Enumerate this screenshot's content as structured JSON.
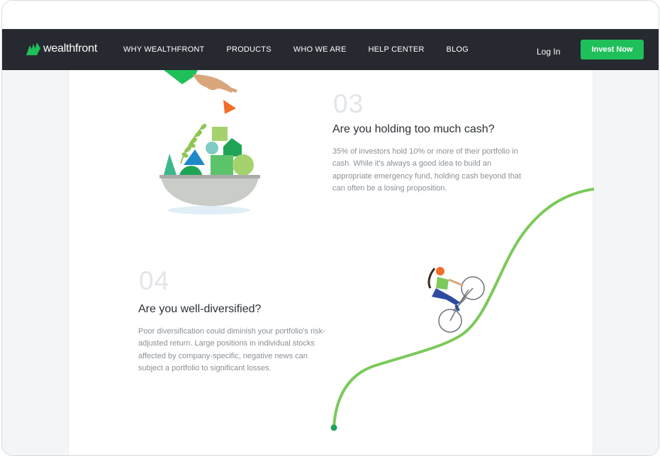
{
  "brand": {
    "name": "wealthfront",
    "accent": "#1fc05a",
    "nav_bg": "#262a30"
  },
  "nav": {
    "links": [
      "WHY WEALTHFRONT",
      "PRODUCTS",
      "WHO WE ARE",
      "HELP CENTER",
      "BLOG"
    ],
    "login_label": "Log In",
    "cta_label": "Invest Now"
  },
  "sections": [
    {
      "number": "03",
      "title": "Are you holding too much cash?",
      "body": "35% of investors hold 10% or more of their portfolio in cash. While it's always a good idea to build an appropriate emergency fund, holding cash beyond that can often be a losing proposition."
    },
    {
      "number": "04",
      "title": "Are you well-diversified?",
      "body": "Poor diversification could diminish your portfolio's risk-adjusted return. Large positions in individual stocks affected by company-specific, negative news can subject a portfolio to significant losses."
    }
  ],
  "icons": {
    "logo": "wealthfront-logo-icon",
    "illustration_bowl": "bowl-of-shapes-illustration",
    "illustration_cyclist": "cyclist-on-curve-illustration"
  }
}
